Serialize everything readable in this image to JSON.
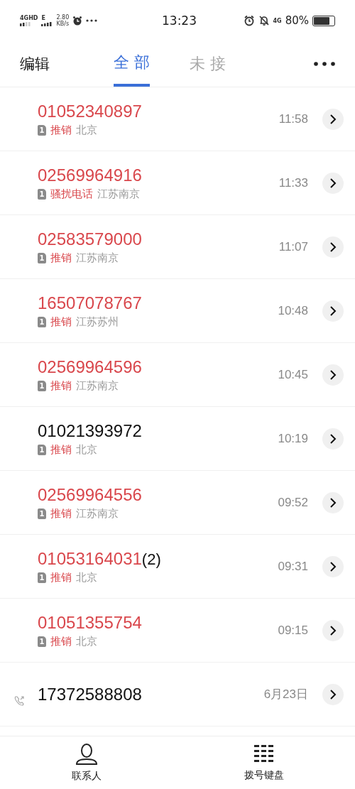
{
  "status_bar": {
    "network_left": "4GHD",
    "network_mid": "E",
    "speed_value": "2.80",
    "speed_unit": "KB/s",
    "time": "13:23",
    "network_right": "4G",
    "battery": "80%"
  },
  "header": {
    "edit": "编辑",
    "tabs": [
      {
        "label": "全 部",
        "selected": true
      },
      {
        "label": "未 接",
        "selected": false
      }
    ]
  },
  "calls": [
    {
      "number": "01052340897",
      "missed": true,
      "sim": "1",
      "tag": "推销",
      "location": "北京",
      "time": "11:58"
    },
    {
      "number": "02569964916",
      "missed": true,
      "sim": "1",
      "tag": "骚扰电话",
      "location": "江苏南京",
      "time": "11:33"
    },
    {
      "number": "02583579000",
      "missed": true,
      "sim": "1",
      "tag": "推销",
      "location": "江苏南京",
      "time": "11:07"
    },
    {
      "number": "16507078767",
      "missed": true,
      "sim": "1",
      "tag": "推销",
      "location": "江苏苏州",
      "time": "10:48"
    },
    {
      "number": "02569964596",
      "missed": true,
      "sim": "1",
      "tag": "推销",
      "location": "江苏南京",
      "time": "10:45"
    },
    {
      "number": "01021393972",
      "missed": false,
      "sim": "1",
      "tag": "推销",
      "location": "北京",
      "time": "10:19"
    },
    {
      "number": "02569964556",
      "missed": true,
      "sim": "1",
      "tag": "推销",
      "location": "江苏南京",
      "time": "09:52"
    },
    {
      "number": "01053164031",
      "count": "(2)",
      "missed": true,
      "sim": "1",
      "tag": "推销",
      "location": "北京",
      "time": "09:31"
    },
    {
      "number": "01051355754",
      "missed": true,
      "sim": "1",
      "tag": "推销",
      "location": "北京",
      "time": "09:15"
    },
    {
      "number": "17372588808",
      "missed": false,
      "outgoing": true,
      "time": "6月23日"
    }
  ],
  "bottom_nav": [
    {
      "label": "联系人",
      "kind": "contacts"
    },
    {
      "label": "拨号键盘",
      "kind": "dialpad"
    }
  ]
}
